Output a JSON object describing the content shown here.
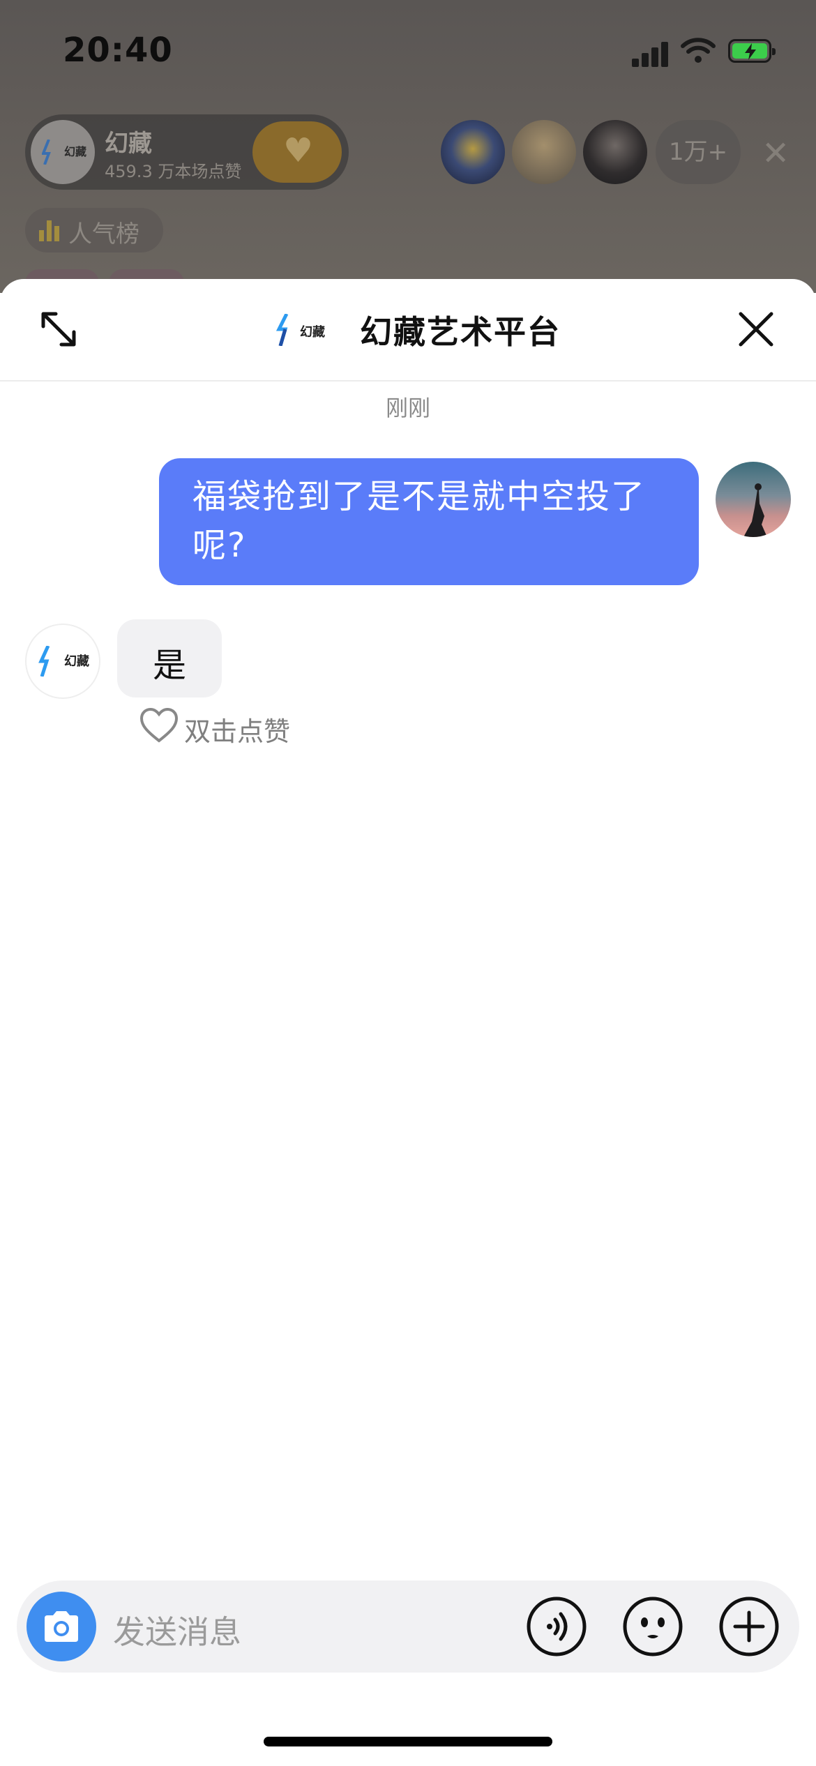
{
  "status_bar": {
    "time": "20:40"
  },
  "live_room": {
    "anchor_name": "幻藏",
    "anchor_avatar_text": "幻藏",
    "anchor_likes": "459.3 万本场点赞",
    "viewer_count": "1万+",
    "rank_label": "人气榜"
  },
  "chat": {
    "title": "幻藏艺术平台",
    "logo_text": "幻藏",
    "timestamp": "刚刚",
    "messages": [
      {
        "from": "me",
        "text": "福袋抢到了是不是就中空投了呢?"
      },
      {
        "from": "platform",
        "text": "是",
        "like_hint": "双击点赞"
      }
    ]
  },
  "input": {
    "placeholder": "发送消息"
  },
  "colors": {
    "outgoing_bubble": "#5a7cf9",
    "incoming_bubble": "#f1f1f3",
    "camera_button": "#3f8ef0",
    "battery_fill": "#3ccd4b"
  },
  "icons": [
    "expand-icon",
    "close-icon",
    "camera-icon",
    "voice-icon",
    "emoji-icon",
    "plus-icon",
    "heart-icon",
    "signal-icon",
    "wifi-icon",
    "battery-icon"
  ]
}
